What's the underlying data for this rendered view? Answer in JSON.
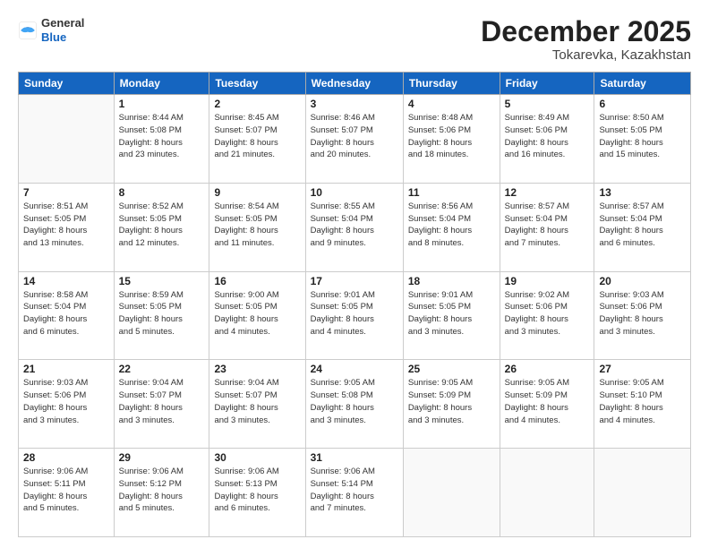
{
  "header": {
    "logo_general": "General",
    "logo_blue": "Blue",
    "month_year": "December 2025",
    "location": "Tokarevka, Kazakhstan"
  },
  "weekdays": [
    "Sunday",
    "Monday",
    "Tuesday",
    "Wednesday",
    "Thursday",
    "Friday",
    "Saturday"
  ],
  "weeks": [
    [
      {
        "day": "",
        "info": ""
      },
      {
        "day": "1",
        "info": "Sunrise: 8:44 AM\nSunset: 5:08 PM\nDaylight: 8 hours\nand 23 minutes."
      },
      {
        "day": "2",
        "info": "Sunrise: 8:45 AM\nSunset: 5:07 PM\nDaylight: 8 hours\nand 21 minutes."
      },
      {
        "day": "3",
        "info": "Sunrise: 8:46 AM\nSunset: 5:07 PM\nDaylight: 8 hours\nand 20 minutes."
      },
      {
        "day": "4",
        "info": "Sunrise: 8:48 AM\nSunset: 5:06 PM\nDaylight: 8 hours\nand 18 minutes."
      },
      {
        "day": "5",
        "info": "Sunrise: 8:49 AM\nSunset: 5:06 PM\nDaylight: 8 hours\nand 16 minutes."
      },
      {
        "day": "6",
        "info": "Sunrise: 8:50 AM\nSunset: 5:05 PM\nDaylight: 8 hours\nand 15 minutes."
      }
    ],
    [
      {
        "day": "7",
        "info": "Sunrise: 8:51 AM\nSunset: 5:05 PM\nDaylight: 8 hours\nand 13 minutes."
      },
      {
        "day": "8",
        "info": "Sunrise: 8:52 AM\nSunset: 5:05 PM\nDaylight: 8 hours\nand 12 minutes."
      },
      {
        "day": "9",
        "info": "Sunrise: 8:54 AM\nSunset: 5:05 PM\nDaylight: 8 hours\nand 11 minutes."
      },
      {
        "day": "10",
        "info": "Sunrise: 8:55 AM\nSunset: 5:04 PM\nDaylight: 8 hours\nand 9 minutes."
      },
      {
        "day": "11",
        "info": "Sunrise: 8:56 AM\nSunset: 5:04 PM\nDaylight: 8 hours\nand 8 minutes."
      },
      {
        "day": "12",
        "info": "Sunrise: 8:57 AM\nSunset: 5:04 PM\nDaylight: 8 hours\nand 7 minutes."
      },
      {
        "day": "13",
        "info": "Sunrise: 8:57 AM\nSunset: 5:04 PM\nDaylight: 8 hours\nand 6 minutes."
      }
    ],
    [
      {
        "day": "14",
        "info": "Sunrise: 8:58 AM\nSunset: 5:04 PM\nDaylight: 8 hours\nand 6 minutes."
      },
      {
        "day": "15",
        "info": "Sunrise: 8:59 AM\nSunset: 5:05 PM\nDaylight: 8 hours\nand 5 minutes."
      },
      {
        "day": "16",
        "info": "Sunrise: 9:00 AM\nSunset: 5:05 PM\nDaylight: 8 hours\nand 4 minutes."
      },
      {
        "day": "17",
        "info": "Sunrise: 9:01 AM\nSunset: 5:05 PM\nDaylight: 8 hours\nand 4 minutes."
      },
      {
        "day": "18",
        "info": "Sunrise: 9:01 AM\nSunset: 5:05 PM\nDaylight: 8 hours\nand 3 minutes."
      },
      {
        "day": "19",
        "info": "Sunrise: 9:02 AM\nSunset: 5:06 PM\nDaylight: 8 hours\nand 3 minutes."
      },
      {
        "day": "20",
        "info": "Sunrise: 9:03 AM\nSunset: 5:06 PM\nDaylight: 8 hours\nand 3 minutes."
      }
    ],
    [
      {
        "day": "21",
        "info": "Sunrise: 9:03 AM\nSunset: 5:06 PM\nDaylight: 8 hours\nand 3 minutes."
      },
      {
        "day": "22",
        "info": "Sunrise: 9:04 AM\nSunset: 5:07 PM\nDaylight: 8 hours\nand 3 minutes."
      },
      {
        "day": "23",
        "info": "Sunrise: 9:04 AM\nSunset: 5:07 PM\nDaylight: 8 hours\nand 3 minutes."
      },
      {
        "day": "24",
        "info": "Sunrise: 9:05 AM\nSunset: 5:08 PM\nDaylight: 8 hours\nand 3 minutes."
      },
      {
        "day": "25",
        "info": "Sunrise: 9:05 AM\nSunset: 5:09 PM\nDaylight: 8 hours\nand 3 minutes."
      },
      {
        "day": "26",
        "info": "Sunrise: 9:05 AM\nSunset: 5:09 PM\nDaylight: 8 hours\nand 4 minutes."
      },
      {
        "day": "27",
        "info": "Sunrise: 9:05 AM\nSunset: 5:10 PM\nDaylight: 8 hours\nand 4 minutes."
      }
    ],
    [
      {
        "day": "28",
        "info": "Sunrise: 9:06 AM\nSunset: 5:11 PM\nDaylight: 8 hours\nand 5 minutes."
      },
      {
        "day": "29",
        "info": "Sunrise: 9:06 AM\nSunset: 5:12 PM\nDaylight: 8 hours\nand 5 minutes."
      },
      {
        "day": "30",
        "info": "Sunrise: 9:06 AM\nSunset: 5:13 PM\nDaylight: 8 hours\nand 6 minutes."
      },
      {
        "day": "31",
        "info": "Sunrise: 9:06 AM\nSunset: 5:14 PM\nDaylight: 8 hours\nand 7 minutes."
      },
      {
        "day": "",
        "info": ""
      },
      {
        "day": "",
        "info": ""
      },
      {
        "day": "",
        "info": ""
      }
    ]
  ]
}
